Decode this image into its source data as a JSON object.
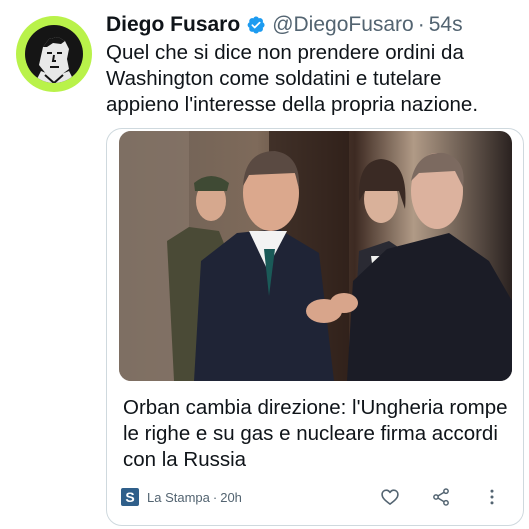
{
  "author": {
    "name": "Diego Fusaro",
    "handle": "@DiegoFusaro",
    "separator": "·",
    "time": "54s"
  },
  "tweet": {
    "text": "Quel che si dice non prendere ordini da Washington come soldatini e tutelare appieno l'interesse della propria nazione."
  },
  "card": {
    "headline": "Orban cambia direzione: l'Ungheria rompe le righe e su gas e nucleare firma accordi con la Russia",
    "source_logo": "S",
    "source_name": "La Stampa",
    "source_separator": "·",
    "source_time": "20h"
  },
  "icons": {
    "verified": "verified-badge-icon",
    "like": "heart-icon",
    "share": "share-icon",
    "more": "more-vertical-icon"
  },
  "colors": {
    "avatar_ring": "#b9f24a",
    "verified": "#1d9bf0",
    "secondary_text": "#536471",
    "border": "#cfd9de",
    "source_logo": "#2f5f8a"
  }
}
